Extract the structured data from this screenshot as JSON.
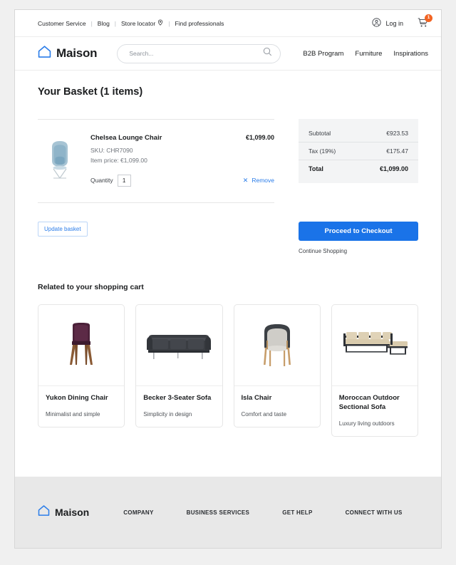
{
  "utility_bar": {
    "links": [
      "Customer Service",
      "Blog",
      "Store locator",
      "Find professionals"
    ],
    "separator": "|",
    "login_label": "Log in",
    "cart_badge_count": "1"
  },
  "header": {
    "brand_name": "Maison",
    "search": {
      "value": "",
      "placeholder": "Search..."
    },
    "nav": [
      "B2B Program",
      "Furniture",
      "Inspirations"
    ]
  },
  "main": {
    "page_title": "Your Basket (1 items)",
    "cart_item": {
      "name": "Chelsea Lounge Chair",
      "price": "€1,099.00",
      "sku": "SKU: CHR7090",
      "item_price": "Item price: €1,099.00",
      "quantity_label": "Quantity",
      "quantity_value": "1",
      "remove_label": "Remove"
    },
    "summary": {
      "rows": [
        {
          "label": "Subtotal",
          "value": "€923.53"
        },
        {
          "label": "Tax (19%)",
          "value": "€175.47"
        }
      ],
      "total": {
        "label": "Total",
        "value": "€1,099.00"
      }
    },
    "actions": {
      "update_label": "Update basket",
      "checkout_label": "Proceed to Checkout",
      "continue_label": "Continue Shopping"
    },
    "related": {
      "title": "Related to your shopping cart",
      "products": [
        {
          "name": "Yukon Dining Chair",
          "desc": "Minimalist and simple"
        },
        {
          "name": "Becker 3-Seater Sofa",
          "desc": "Simplicity in design"
        },
        {
          "name": "Isla Chair",
          "desc": "Comfort and taste"
        },
        {
          "name": "Moroccan Outdoor Sectional Sofa",
          "desc": "Luxury living outdoors"
        }
      ]
    }
  },
  "footer": {
    "brand_name": "Maison",
    "columns": [
      "COMPANY",
      "BUSINESS SERVICES",
      "GET HELP",
      "CONNECT WITH US"
    ]
  },
  "colors": {
    "accent_blue": "#1a73e8",
    "link_blue": "#2b7de9",
    "badge_orange": "#f26322",
    "footer_gray": "#e8e8e8",
    "summary_gray": "#f3f4f5"
  }
}
